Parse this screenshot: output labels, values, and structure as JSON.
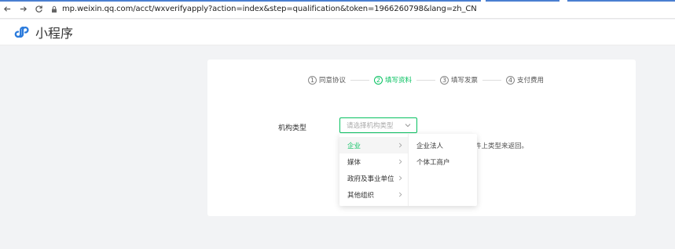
{
  "browser": {
    "url": "mp.weixin.qq.com/acct/wxverifyapply?action=index&step=qualification&token=1966260798&lang=zh_CN"
  },
  "header": {
    "title": "小程序"
  },
  "steps": [
    {
      "num": "1",
      "label": "同意协议"
    },
    {
      "num": "2",
      "label": "填写资料"
    },
    {
      "num": "3",
      "label": "填写发票"
    },
    {
      "num": "4",
      "label": "支付费用"
    }
  ],
  "form": {
    "field_label": "机构类型",
    "select_placeholder": "请选择机构类型",
    "hint": "件上类型来返回。"
  },
  "cascader": {
    "level1": [
      "企业",
      "媒体",
      "政府及事业单位",
      "其他组织"
    ],
    "level2": [
      "企业法人",
      "个体工商户"
    ]
  },
  "colors": {
    "accent": "#07c160"
  }
}
